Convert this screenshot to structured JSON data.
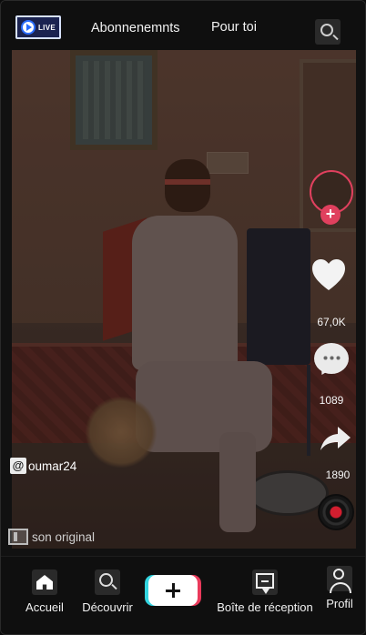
{
  "topbar": {
    "live_icon": "live-icon",
    "live_label": "LIVE",
    "tabs": [
      {
        "label": "Abonnenemnts"
      },
      {
        "label": "Pour toi"
      }
    ],
    "search_icon": "search-icon"
  },
  "actions": {
    "follow_icon": "plus-icon",
    "like_count": "67,0K",
    "comment_count": "1089",
    "share_count": "1890"
  },
  "caption": {
    "at_symbol": "@",
    "username": "oumar24",
    "sound": "son original"
  },
  "bottom_nav": {
    "home": "Accueil",
    "discover": "Découvrir",
    "inbox": "Boîte de réception",
    "profile": "Profil"
  },
  "colors": {
    "accent_red": "#e0405e",
    "accent_cyan": "#33d5e0",
    "background": "#0f0f0f"
  }
}
